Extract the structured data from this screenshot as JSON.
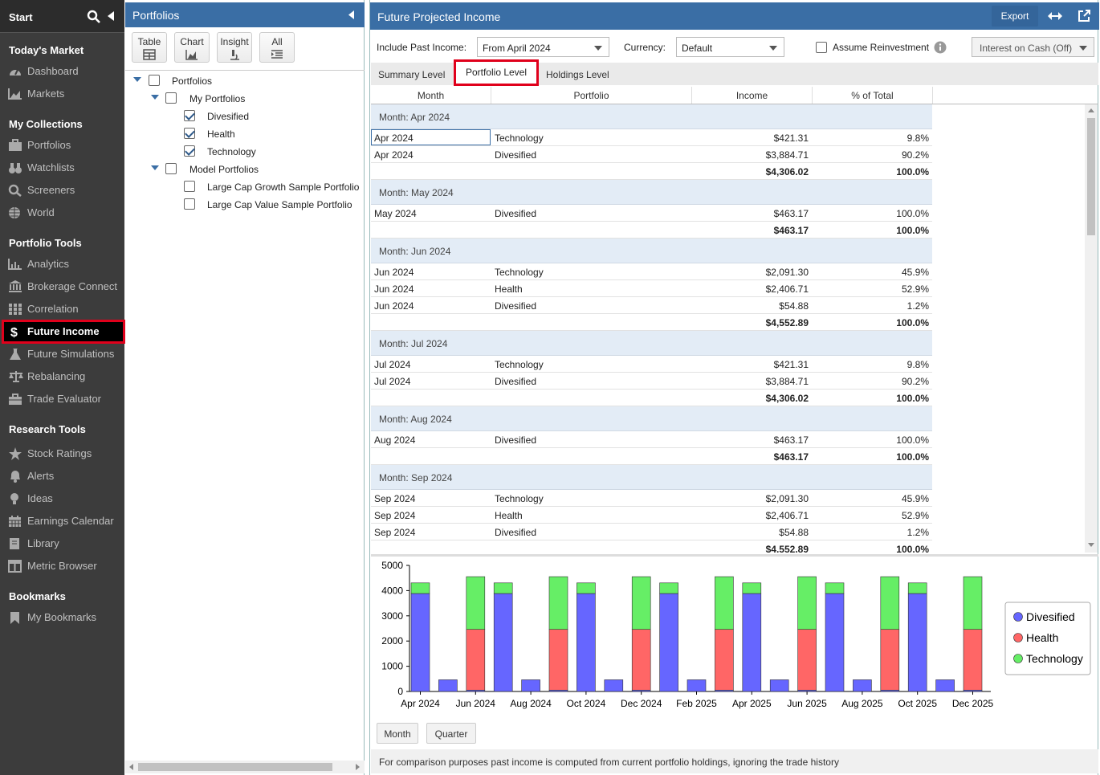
{
  "nav": {
    "start": "Start",
    "sections": {
      "todays_market": "Today's Market",
      "my_collections": "My Collections",
      "portfolio_tools": "Portfolio Tools",
      "research_tools": "Research Tools",
      "bookmarks": "Bookmarks"
    },
    "items": {
      "dashboard": "Dashboard",
      "markets": "Markets",
      "portfolios": "Portfolios",
      "watchlists": "Watchlists",
      "screeners": "Screeners",
      "world": "World",
      "analytics": "Analytics",
      "brokerage": "Brokerage Connect",
      "correlation": "Correlation",
      "future_income": "Future Income",
      "future_sim": "Future Simulations",
      "rebalancing": "Rebalancing",
      "trade_eval": "Trade Evaluator",
      "stock_ratings": "Stock Ratings",
      "alerts": "Alerts",
      "ideas": "Ideas",
      "earnings": "Earnings Calendar",
      "library": "Library",
      "metric_browser": "Metric Browser",
      "my_bookmarks": "My Bookmarks"
    }
  },
  "portfolios_panel": {
    "title": "Portfolios",
    "views": {
      "table": "Table",
      "chart": "Chart",
      "insight": "Insight",
      "all": "All"
    },
    "tree": {
      "root": "Portfolios",
      "my_portfolios": "My Portfolios",
      "divesified": "Divesified",
      "health": "Health",
      "technology": "Technology",
      "model_portfolios": "Model Portfolios",
      "large_growth": "Large Cap Growth Sample Portfolio",
      "large_value": "Large Cap Value Sample Portfolio"
    }
  },
  "main": {
    "title": "Future Projected Income",
    "export": "Export",
    "include_past_label": "Include Past Income:",
    "include_past_value": "From April 2024",
    "currency_label": "Currency:",
    "currency_value": "Default",
    "reinvest_label": "Assume Reinvestment",
    "interest_value": "Interest on Cash (Off)",
    "tabs": {
      "summary": "Summary Level",
      "portfolio": "Portfolio Level",
      "holdings": "Holdings Level"
    },
    "columns": {
      "month": "Month",
      "portfolio": "Portfolio",
      "income": "Income",
      "pct": "% of Total"
    },
    "footer_note": "For comparison purposes past income is computed from current portfolio holdings, ignoring the trade history",
    "btn_month": "Month",
    "btn_quarter": "Quarter"
  },
  "grid": [
    {
      "group": "Month: Apr 2024",
      "rows": [
        [
          "Apr 2024",
          "Technology",
          "$421.31",
          "9.8%"
        ],
        [
          "Apr 2024",
          "Divesified",
          "$3,884.71",
          "90.2%"
        ]
      ],
      "total": [
        "$4,306.02",
        "100.0%"
      ]
    },
    {
      "group": "Month: May 2024",
      "rows": [
        [
          "May 2024",
          "Divesified",
          "$463.17",
          "100.0%"
        ]
      ],
      "total": [
        "$463.17",
        "100.0%"
      ]
    },
    {
      "group": "Month: Jun 2024",
      "rows": [
        [
          "Jun 2024",
          "Technology",
          "$2,091.30",
          "45.9%"
        ],
        [
          "Jun 2024",
          "Health",
          "$2,406.71",
          "52.9%"
        ],
        [
          "Jun 2024",
          "Divesified",
          "$54.88",
          "1.2%"
        ]
      ],
      "total": [
        "$4,552.89",
        "100.0%"
      ]
    },
    {
      "group": "Month: Jul 2024",
      "rows": [
        [
          "Jul 2024",
          "Technology",
          "$421.31",
          "9.8%"
        ],
        [
          "Jul 2024",
          "Divesified",
          "$3,884.71",
          "90.2%"
        ]
      ],
      "total": [
        "$4,306.02",
        "100.0%"
      ]
    },
    {
      "group": "Month: Aug 2024",
      "rows": [
        [
          "Aug 2024",
          "Divesified",
          "$463.17",
          "100.0%"
        ]
      ],
      "total": [
        "$463.17",
        "100.0%"
      ]
    },
    {
      "group": "Month: Sep 2024",
      "rows": [
        [
          "Sep 2024",
          "Technology",
          "$2,091.30",
          "45.9%"
        ],
        [
          "Sep 2024",
          "Health",
          "$2,406.71",
          "52.9%"
        ],
        [
          "Sep 2024",
          "Divesified",
          "$54.88",
          "1.2%"
        ]
      ],
      "total": [
        "$4,552.89",
        "100.0%"
      ]
    }
  ],
  "chart_data": {
    "type": "bar",
    "stacked": true,
    "categories": [
      "Apr 2024",
      "May 2024",
      "Jun 2024",
      "Jul 2024",
      "Aug 2024",
      "Sep 2024",
      "Oct 2024",
      "Nov 2024",
      "Dec 2024",
      "Jan 2025",
      "Feb 2025",
      "Mar 2025",
      "Apr 2025",
      "May 2025",
      "Jun 2025",
      "Jul 2025",
      "Aug 2025",
      "Sep 2025",
      "Oct 2025",
      "Nov 2025",
      "Dec 2025"
    ],
    "tick_labels": [
      "Apr 2024",
      "Jun 2024",
      "Aug 2024",
      "Oct 2024",
      "Dec 2024",
      "Feb 2025",
      "Apr 2025",
      "Jun 2025",
      "Aug 2025",
      "Oct 2025",
      "Dec 2025"
    ],
    "series": [
      {
        "name": "Divesified",
        "color": "#6666ff",
        "values": [
          3884.71,
          463.17,
          54.88,
          3884.71,
          463.17,
          54.88,
          3884.71,
          463.17,
          54.88,
          3884.71,
          463.17,
          54.88,
          3884.71,
          463.17,
          54.88,
          3884.71,
          463.17,
          54.88,
          3884.71,
          463.17,
          54.88
        ]
      },
      {
        "name": "Health",
        "color": "#ff6666",
        "values": [
          0,
          0,
          2406.71,
          0,
          0,
          2406.71,
          0,
          0,
          2406.71,
          0,
          0,
          2406.71,
          0,
          0,
          2406.71,
          0,
          0,
          2406.71,
          0,
          0,
          2406.71
        ]
      },
      {
        "name": "Technology",
        "color": "#66ee66",
        "values": [
          421.31,
          0,
          2091.3,
          421.31,
          0,
          2091.3,
          421.31,
          0,
          2091.3,
          421.31,
          0,
          2091.3,
          421.31,
          0,
          2091.3,
          421.31,
          0,
          2091.3,
          421.31,
          0,
          2091.3
        ]
      }
    ],
    "yticks": [
      0,
      1000,
      2000,
      3000,
      4000,
      5000
    ],
    "ylim": [
      0,
      5000
    ],
    "legend_position": "right"
  }
}
